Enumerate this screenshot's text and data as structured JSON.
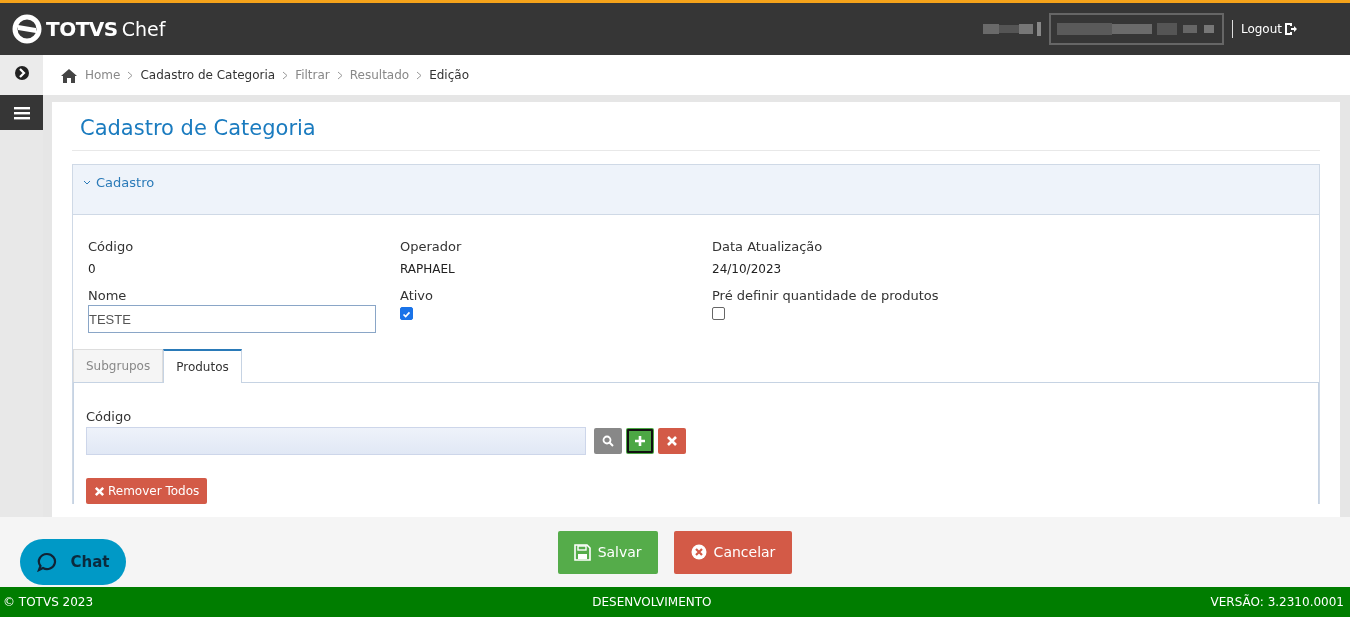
{
  "header": {
    "logo_brand": "TOTVS",
    "logo_product": "Chef",
    "logout": "Logout"
  },
  "breadcrumb": [
    {
      "label": "Home",
      "current": false
    },
    {
      "label": "Cadastro de Categoria",
      "current": true
    },
    {
      "label": "Filtrar",
      "current": false
    },
    {
      "label": "Resultado",
      "current": false
    },
    {
      "label": "Edição",
      "current": true
    }
  ],
  "page_title": "Cadastro de Categoria",
  "section": {
    "title": "Cadastro",
    "expanded": true
  },
  "fields": [
    {
      "label": "Código",
      "kind": "text",
      "value": "0"
    },
    {
      "label": "Operador",
      "kind": "text",
      "value": "RAPHAEL"
    },
    {
      "label": "Data Atualização",
      "kind": "text",
      "value": "24/10/2023"
    },
    {
      "label": "Nome",
      "kind": "input",
      "value": "TESTE"
    },
    {
      "label": "Ativo",
      "kind": "checkbox",
      "checked": true
    },
    {
      "label": "Pré definir quantidade de produtos",
      "kind": "checkbox",
      "checked": false
    }
  ],
  "tabs": [
    {
      "label": "Subgrupos",
      "selected": false
    },
    {
      "label": "Produtos",
      "selected": true
    }
  ],
  "product_code": {
    "label": "Código"
  },
  "remove_all": "Remover Todos",
  "actions": [
    {
      "label": "Salvar",
      "kind": "save"
    },
    {
      "label": "Cancelar",
      "kind": "cancel"
    }
  ],
  "chat": "Chat",
  "footer": {
    "copyright": "© TOTVS 2023",
    "environment": "DESENVOLVIMENTO",
    "version": "VERSÃO: 3.2310.0001"
  }
}
